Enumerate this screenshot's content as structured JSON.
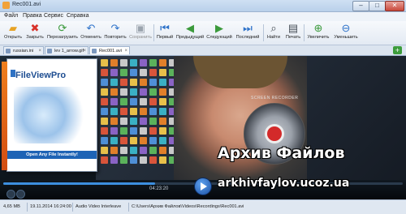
{
  "window": {
    "title": "Rec001.avi",
    "min_label": "–",
    "max_label": "□",
    "close_label": "✕"
  },
  "menu": {
    "items": [
      "Файл",
      "Правка",
      "Сервис",
      "Справка"
    ]
  },
  "toolbar": {
    "buttons": [
      {
        "label": "Открыть",
        "icon": "folder-open-icon",
        "glyph": "📂",
        "color": "#e7a325"
      },
      {
        "label": "Закрыть",
        "icon": "close-x-icon",
        "glyph": "✖",
        "color": "#d8322a"
      },
      {
        "label": "Перезагрузить",
        "icon": "reload-icon",
        "glyph": "⟳",
        "color": "#3b9a3b"
      },
      {
        "label": "Отменить",
        "icon": "undo-icon",
        "glyph": "↶",
        "color": "#2e72c9"
      },
      {
        "label": "Повторить",
        "icon": "redo-icon",
        "glyph": "↷",
        "color": "#2e72c9"
      },
      {
        "label": "Сохранить",
        "icon": "save-icon",
        "glyph": "💾",
        "color": "#9aa3ad",
        "disabled": true
      },
      {
        "label": "Первый",
        "icon": "first-icon",
        "glyph": "⏮",
        "color": "#2e72c9"
      },
      {
        "label": "Предыдущий",
        "icon": "previous-icon",
        "glyph": "◀",
        "color": "#3b9a3b"
      },
      {
        "label": "Следующий",
        "icon": "next-icon",
        "glyph": "▶",
        "color": "#3b9a3b"
      },
      {
        "label": "Последний",
        "icon": "last-icon",
        "glyph": "⏭",
        "color": "#2e72c9"
      },
      {
        "label": "Найти",
        "icon": "find-icon",
        "glyph": "🔍",
        "color": "#444c55"
      },
      {
        "label": "Печать",
        "icon": "print-icon",
        "glyph": "🖶",
        "color": "#444c55"
      },
      {
        "label": "Увеличить",
        "icon": "zoom-in-icon",
        "glyph": "⊕",
        "color": "#3b9a3b"
      },
      {
        "label": "Уменьшить",
        "icon": "zoom-out-icon",
        "glyph": "⊖",
        "color": "#2e72c9"
      }
    ]
  },
  "tabs": [
    {
      "label": "russian.ini",
      "active": false
    },
    {
      "label": "lev 1_arrow.gif",
      "active": false
    },
    {
      "label": "Rec001.avi",
      "active": true
    }
  ],
  "tab_add_label": "+",
  "video": {
    "product_name": "FileViewPro",
    "product_slogan": "Open Any File Instantly!",
    "recorder_label": "SCREEN RECORDER",
    "watermark_title": "Архив Файлов",
    "watermark_url": "arkhivfaylov.ucoz.ua"
  },
  "player": {
    "timecode": "04:23:20",
    "progress": 0.38
  },
  "statusbar": {
    "size": "4,65 MB",
    "date": "19.11.2014 16:24:00",
    "format": "Audio Video Interleave",
    "path": "C:\\Users\\Архив Файлов\\Videos\\Recordings\\Rec001.avi"
  },
  "colors": {
    "accent": "#2e72c9",
    "record": "#d32a2a",
    "progress": "#3d8fe0"
  }
}
